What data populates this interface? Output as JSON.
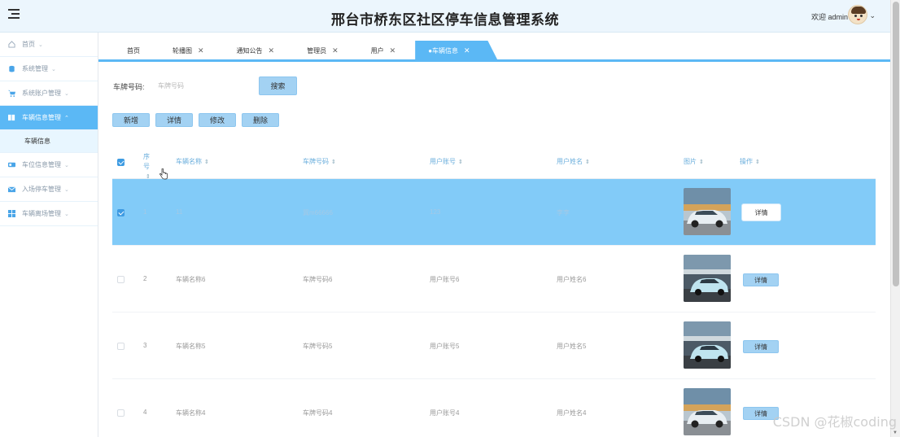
{
  "header": {
    "title": "邢台市桥东区社区停车信息管理系统",
    "welcome": "欢迎 admin"
  },
  "sidebar": {
    "items": [
      {
        "label": "首页",
        "icon": "home-icon"
      },
      {
        "label": "系统管理",
        "icon": "database-icon"
      },
      {
        "label": "系统账户管理",
        "icon": "cart-icon"
      },
      {
        "label": "车辆信息管理",
        "icon": "columns-icon",
        "active": true
      },
      {
        "label": "车位信息管理",
        "icon": "id-card-icon"
      },
      {
        "label": "入场停车管理",
        "icon": "envelope-icon"
      },
      {
        "label": "车辆离场管理",
        "icon": "grid-icon"
      }
    ],
    "subitem": "车辆信息"
  },
  "tabs": [
    {
      "label": "首页"
    },
    {
      "label": "轮播图"
    },
    {
      "label": "通知公告"
    },
    {
      "label": "管理员"
    },
    {
      "label": "用户"
    },
    {
      "label": "●车辆信息",
      "active": true
    }
  ],
  "search": {
    "label": "车牌号码:",
    "placeholder": "车牌号码",
    "button": "搜索"
  },
  "actions": {
    "add": "新增",
    "detail": "详情",
    "edit": "修改",
    "delete": "删除"
  },
  "table": {
    "headers": {
      "index": "序号",
      "name": "车辆名称",
      "plate": "车牌号码",
      "account": "用户账号",
      "username": "用户姓名",
      "image": "图片",
      "ops": "操作"
    },
    "rows": [
      {
        "index": "1",
        "name": "11",
        "plate": "冀m66666",
        "account": "123",
        "username": "李李",
        "detail": "详情",
        "selected": true
      },
      {
        "index": "2",
        "name": "车辆名称6",
        "plate": "车牌号码6",
        "account": "用户账号6",
        "username": "用户姓名6",
        "detail": "详情"
      },
      {
        "index": "3",
        "name": "车辆名称5",
        "plate": "车牌号码5",
        "account": "用户账号5",
        "username": "用户姓名5",
        "detail": "详情"
      },
      {
        "index": "4",
        "name": "车辆名称4",
        "plate": "车牌号码4",
        "account": "用户账号4",
        "username": "用户姓名4",
        "detail": "详情"
      }
    ]
  },
  "watermark": "CSDN @花椒coding",
  "colors": {
    "accent": "#5bb8f5",
    "selected_row": "#82cbf8",
    "button": "#a3d2f3",
    "header_bg": "#ecf6fd"
  }
}
